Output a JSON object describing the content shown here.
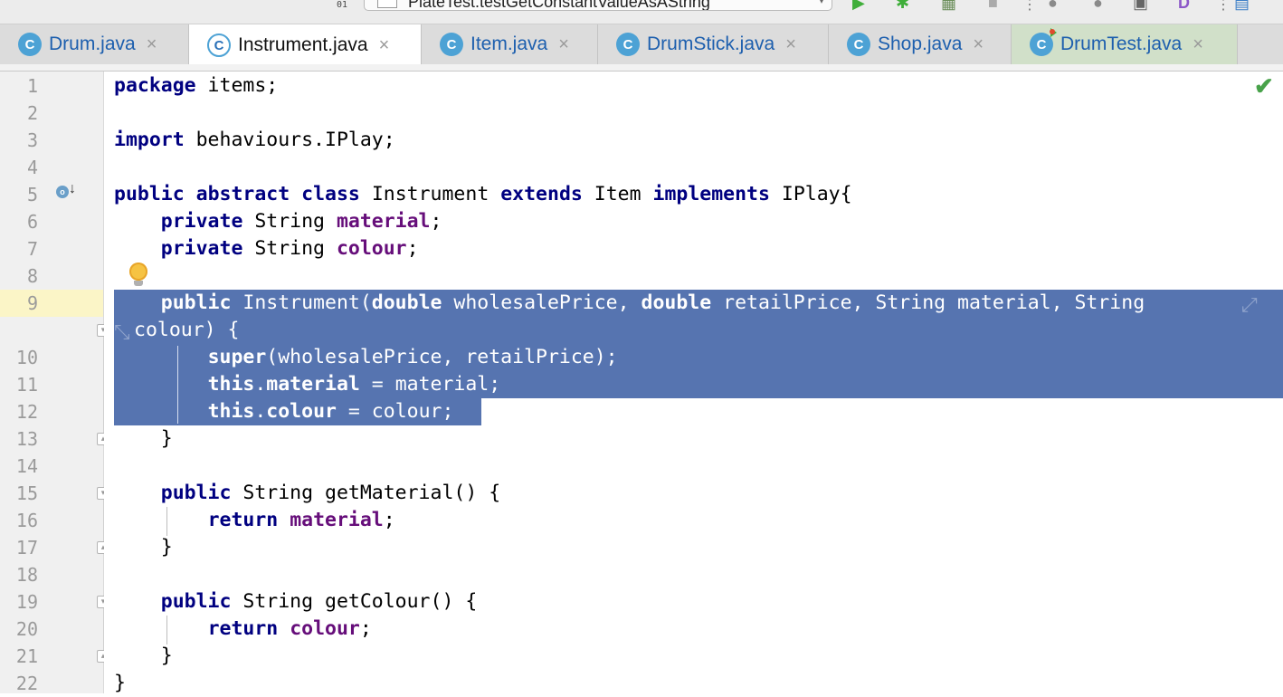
{
  "toolbar": {
    "run_config": "PlateTest.testGetConstantValueAsAString",
    "dropdown_arrow": "▾",
    "counter_label": "01"
  },
  "tabs": [
    {
      "label": "Drum.java",
      "close": "×"
    },
    {
      "label": "Instrument.java",
      "close": "×"
    },
    {
      "label": "Item.java",
      "close": "×"
    },
    {
      "label": "DrumStick.java",
      "close": "×"
    },
    {
      "label": "Shop.java",
      "close": "×"
    },
    {
      "label": "DrumTest.java",
      "close": "×"
    }
  ],
  "class_icon_letter": "C",
  "gutter": {
    "line_numbers": [
      "1",
      "2",
      "3",
      "4",
      "5",
      "6",
      "7",
      "8",
      "9",
      "",
      "10",
      "11",
      "12",
      "13",
      "14",
      "15",
      "16",
      "17",
      "18",
      "19",
      "20",
      "21",
      "22"
    ],
    "override_icon_letter": "o"
  },
  "editor": {
    "inspection_status": "ok",
    "selection_color": "#5674b0",
    "keyword_color": "#000080",
    "field_color": "#660e7a",
    "current_line_color": "#fbf5c7",
    "code": {
      "l1a": "package",
      "l1b": " items;",
      "l3a": "import",
      "l3b": " behaviours.IPlay;",
      "l5a": "public",
      "l5b": " ",
      "l5c": "abstract",
      "l5d": " ",
      "l5e": "class",
      "l5f": " Instrument ",
      "l5g": "extends",
      "l5h": " Item ",
      "l5i": "implements",
      "l5j": " IPlay{",
      "l6a": "    ",
      "l6b": "private",
      "l6c": " String ",
      "l6d": "material",
      "l6e": ";",
      "l7a": "    ",
      "l7b": "private",
      "l7c": " String ",
      "l7d": "colour",
      "l7e": ";",
      "l9a": "    ",
      "l9b": "public",
      "l9c": " Instrument(",
      "l9d": "double",
      "l9e": " wholesalePrice, ",
      "l9f": "double",
      "l9g": " retailPrice, String material, String",
      "l9w": "colour) {",
      "l10a": "        ",
      "l10b": "super",
      "l10c": "(wholesalePrice, retailPrice);",
      "l11a": "        ",
      "l11b": "this",
      "l11c": ".",
      "l11d": "material",
      "l11e": " = material;",
      "l12a": "        ",
      "l12b": "this",
      "l12c": ".",
      "l12d": "colour",
      "l12e": " = colour;",
      "l13": "    }",
      "l15a": "    ",
      "l15b": "public",
      "l15c": " String getMaterial() {",
      "l16a": "        ",
      "l16b": "return",
      "l16c": " ",
      "l16d": "material",
      "l16e": ";",
      "l17": "    }",
      "l19a": "    ",
      "l19b": "public",
      "l19c": " String getColour() {",
      "l20a": "        ",
      "l20b": "return",
      "l20c": " ",
      "l20d": "colour",
      "l20e": ";",
      "l21": "    }",
      "l22": "}"
    }
  }
}
